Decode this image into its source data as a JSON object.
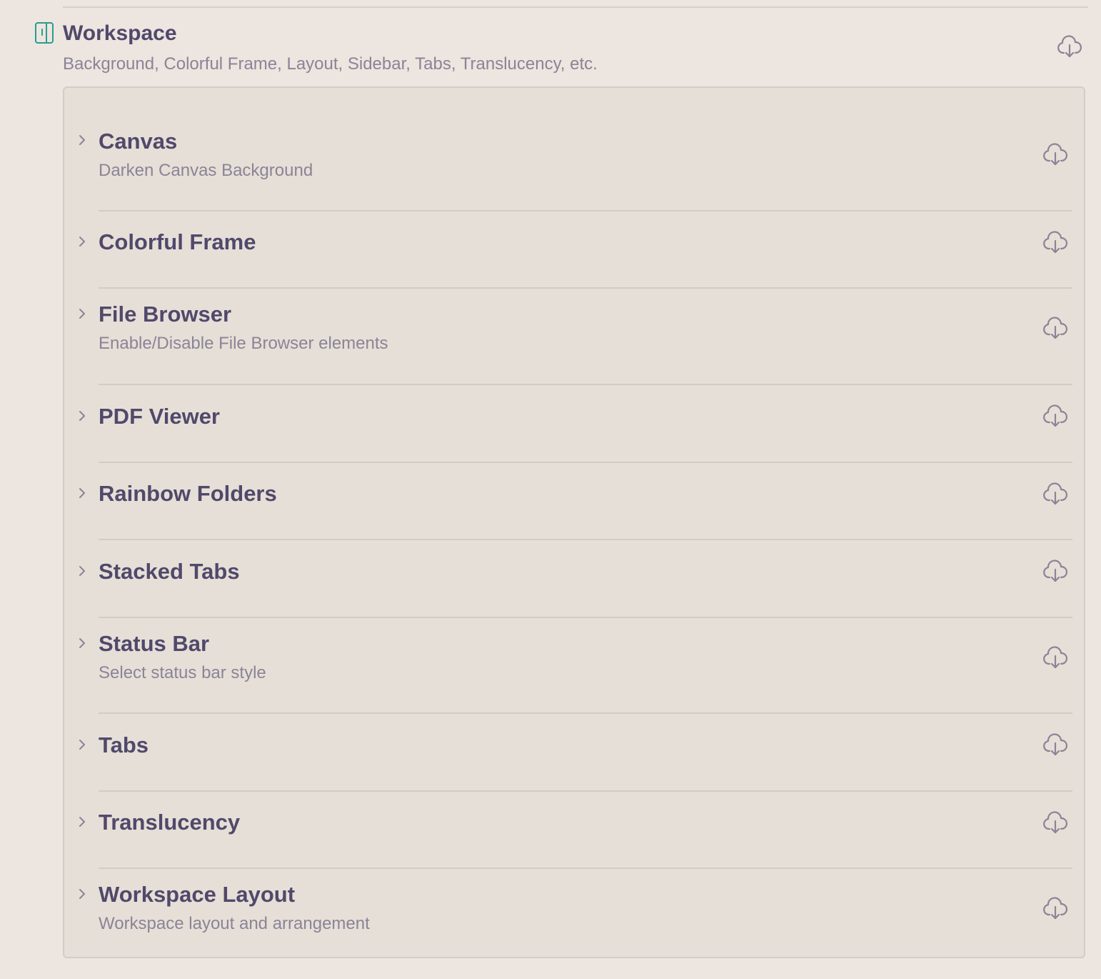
{
  "header": {
    "title": "Workspace",
    "description": "Background, Colorful Frame, Layout, Sidebar, Tabs, Translucency, etc.",
    "icon": "workspace-layout-icon",
    "accent_color": "#2a9d8f"
  },
  "items": [
    {
      "title": "Canvas",
      "description": "Darken Canvas Background"
    },
    {
      "title": "Colorful Frame",
      "description": ""
    },
    {
      "title": "File Browser",
      "description": "Enable/Disable File Browser elements"
    },
    {
      "title": "PDF Viewer",
      "description": ""
    },
    {
      "title": "Rainbow Folders",
      "description": ""
    },
    {
      "title": "Stacked Tabs",
      "description": ""
    },
    {
      "title": "Status Bar",
      "description": "Select status bar style"
    },
    {
      "title": "Tabs",
      "description": ""
    },
    {
      "title": "Translucency",
      "description": ""
    },
    {
      "title": "Workspace Layout",
      "description": "Workspace layout and arrangement"
    }
  ],
  "icons": {
    "expand": "chevron-right-icon",
    "action": "cloud-download-icon"
  },
  "colors": {
    "background": "#ede5df",
    "panel": "#e6dfd7",
    "text": "#51496b",
    "muted": "#8a8497",
    "divider": "#d3ccc6"
  }
}
